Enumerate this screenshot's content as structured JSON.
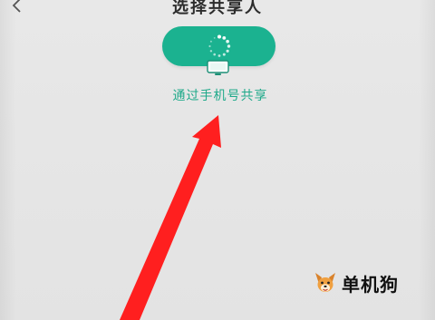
{
  "header": {
    "title": "选择共享人",
    "back_icon": "chevron-left-icon"
  },
  "main": {
    "share_button": {
      "spinner_icon": "loading-spinner-icon",
      "phone_icon": "mobile-phone-icon"
    },
    "share_label": "通过手机号共享"
  },
  "annotation": {
    "arrow_icon": "red-arrow-icon",
    "arrow_color": "#ff1f1f"
  },
  "watermark": {
    "logo_icon": "dog-logo-icon",
    "text": "单机狗"
  },
  "colors": {
    "accent": "#1bb290",
    "label": "#1fa98a",
    "background": "#e6e6e6"
  }
}
